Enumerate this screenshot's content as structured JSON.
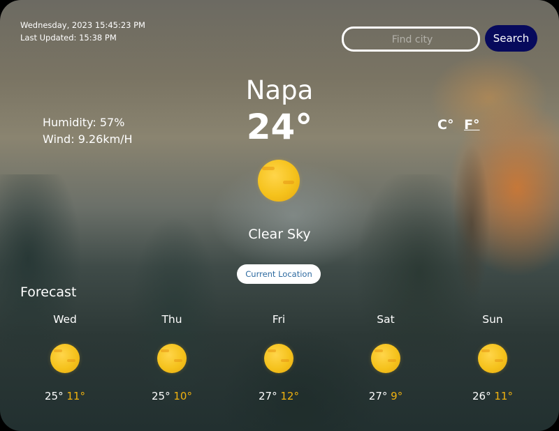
{
  "header": {
    "datetime": "Wednesday, 2023 15:45:23 PM",
    "last_updated": "Last Updated: 15:38 PM"
  },
  "search": {
    "placeholder": "Find city",
    "value": "",
    "button_label": "Search"
  },
  "current": {
    "city": "Napa",
    "temperature": "24°",
    "humidity": "Humidity: 57%",
    "wind": "Wind: 9.26km/H",
    "condition": "Clear Sky",
    "icon": "sun-icon"
  },
  "units": {
    "celsius": "C°",
    "fahrenheit": "F°",
    "selected": "fahrenheit"
  },
  "location_button": "Current Location",
  "forecast": {
    "title": "Forecast",
    "days": [
      {
        "day": "Wed",
        "high": "25°",
        "low": "11°",
        "icon": "sun-icon"
      },
      {
        "day": "Thu",
        "high": "25°",
        "low": "10°",
        "icon": "sun-icon"
      },
      {
        "day": "Fri",
        "high": "27°",
        "low": "12°",
        "icon": "sun-icon"
      },
      {
        "day": "Sat",
        "high": "27°",
        "low": "9°",
        "icon": "sun-icon"
      },
      {
        "day": "Sun",
        "high": "26°",
        "low": "11°",
        "icon": "sun-icon"
      }
    ]
  },
  "colors": {
    "search_button": "#070a5c",
    "low_temp": "#f0b20f",
    "location_button_text": "#2d6aa0"
  }
}
